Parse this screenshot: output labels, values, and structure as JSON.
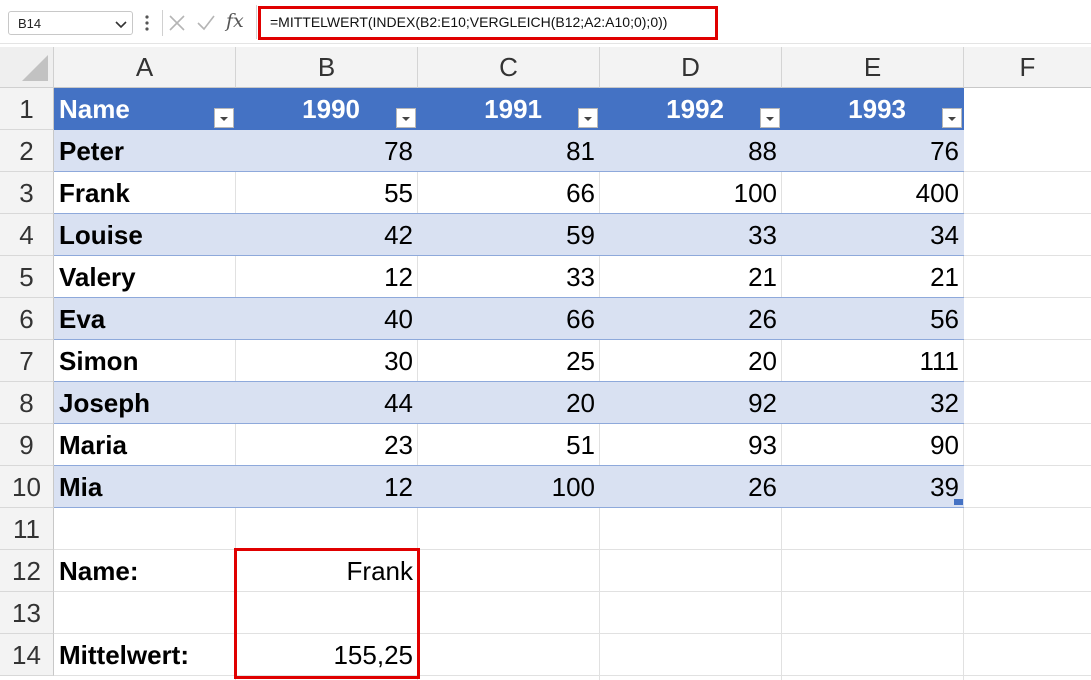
{
  "formula_bar": {
    "name_box": "B14",
    "fx_label": "fx",
    "formula": "=MITTELWERT(INDEX(B2:E10;VERGLEICH(B12;A2:A10;0);0))"
  },
  "columns": [
    "A",
    "B",
    "C",
    "D",
    "E",
    "F"
  ],
  "rows": [
    "1",
    "2",
    "3",
    "4",
    "5",
    "6",
    "7",
    "8",
    "9",
    "10",
    "11",
    "12",
    "13",
    "14"
  ],
  "table": {
    "headers": [
      "Name",
      "1990",
      "1991",
      "1992",
      "1993"
    ],
    "data": [
      [
        "Peter",
        "78",
        "81",
        "88",
        "76"
      ],
      [
        "Frank",
        "55",
        "66",
        "100",
        "400"
      ],
      [
        "Louise",
        "42",
        "59",
        "33",
        "34"
      ],
      [
        "Valery",
        "12",
        "33",
        "21",
        "21"
      ],
      [
        "Eva",
        "40",
        "66",
        "26",
        "56"
      ],
      [
        "Simon",
        "30",
        "25",
        "20",
        "111"
      ],
      [
        "Joseph",
        "44",
        "20",
        "92",
        "32"
      ],
      [
        "Maria",
        "23",
        "51",
        "93",
        "90"
      ],
      [
        "Mia",
        "12",
        "100",
        "26",
        "39"
      ]
    ]
  },
  "lookup": {
    "name_label": "Name:",
    "name_value": "Frank",
    "avg_label": "Mittelwert:",
    "avg_value": "155,25"
  },
  "colors": {
    "header_fill": "#4472C4",
    "band_fill": "#D9E1F2",
    "highlight": "#E00000"
  }
}
